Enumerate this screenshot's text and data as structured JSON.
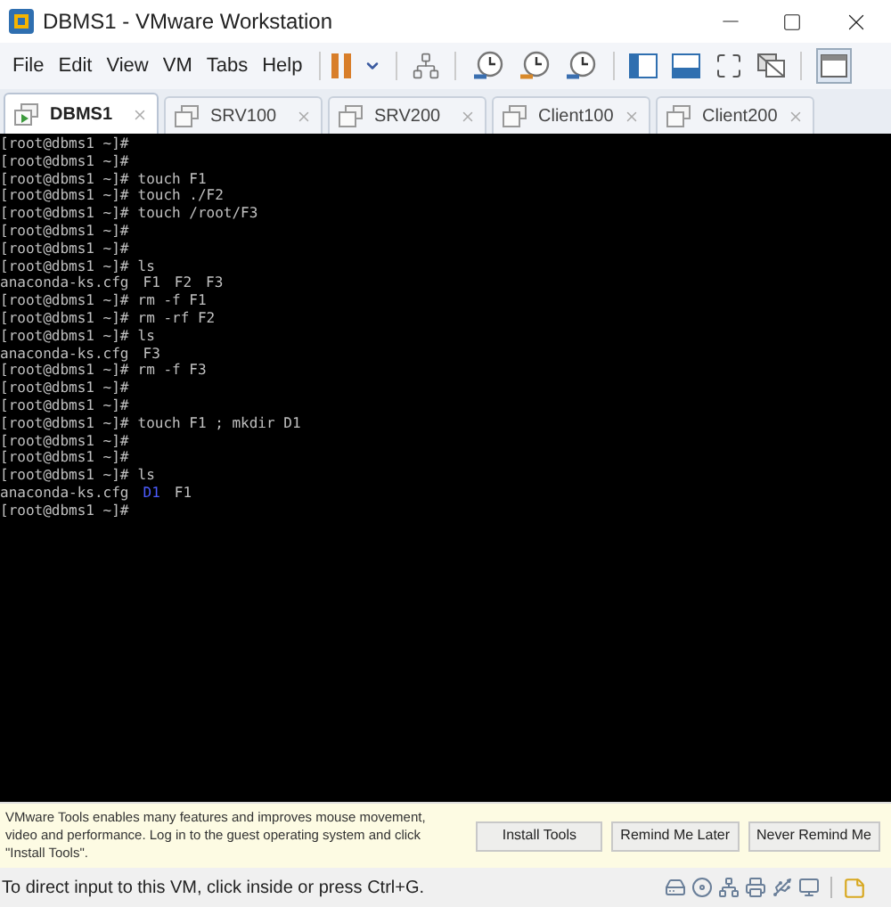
{
  "window": {
    "title": "DBMS1 - VMware Workstation"
  },
  "menu": [
    "File",
    "Edit",
    "View",
    "VM",
    "Tabs",
    "Help"
  ],
  "tabs": [
    {
      "label": "DBMS1",
      "selected": true
    },
    {
      "label": "SRV100",
      "selected": false
    },
    {
      "label": "SRV200",
      "selected": false
    },
    {
      "label": "Client100",
      "selected": false
    },
    {
      "label": "Client200",
      "selected": false
    }
  ],
  "terminal": {
    "lines": [
      {
        "kind": "prompt",
        "prompt": "[root@dbms1 ~]#"
      },
      {
        "kind": "prompt",
        "prompt": "[root@dbms1 ~]#"
      },
      {
        "kind": "prompt",
        "prompt": "[root@dbms1 ~]#",
        "command": "touch F1"
      },
      {
        "kind": "prompt",
        "prompt": "[root@dbms1 ~]#",
        "command": "touch ./F2"
      },
      {
        "kind": "prompt",
        "prompt": "[root@dbms1 ~]#",
        "command": "touch /root/F3"
      },
      {
        "kind": "prompt",
        "prompt": "[root@dbms1 ~]#"
      },
      {
        "kind": "prompt",
        "prompt": "[root@dbms1 ~]#"
      },
      {
        "kind": "prompt",
        "prompt": "[root@dbms1 ~]#",
        "command": "ls"
      },
      {
        "kind": "output",
        "items": [
          {
            "text": "anaconda-ks.cfg",
            "color": "#c0c0c0"
          },
          {
            "text": "F1",
            "color": "#c0c0c0"
          },
          {
            "text": "F2",
            "color": "#c0c0c0"
          },
          {
            "text": "F3",
            "color": "#c0c0c0"
          }
        ]
      },
      {
        "kind": "prompt",
        "prompt": "[root@dbms1 ~]#",
        "command": "rm -f F1"
      },
      {
        "kind": "prompt",
        "prompt": "[root@dbms1 ~]#",
        "command": "rm -rf F2"
      },
      {
        "kind": "prompt",
        "prompt": "[root@dbms1 ~]#",
        "command": "ls"
      },
      {
        "kind": "output",
        "items": [
          {
            "text": "anaconda-ks.cfg",
            "color": "#c0c0c0"
          },
          {
            "text": "F3",
            "color": "#c0c0c0"
          }
        ]
      },
      {
        "kind": "prompt",
        "prompt": "[root@dbms1 ~]#",
        "command": "rm -f F3"
      },
      {
        "kind": "prompt",
        "prompt": "[root@dbms1 ~]#"
      },
      {
        "kind": "prompt",
        "prompt": "[root@dbms1 ~]#"
      },
      {
        "kind": "prompt",
        "prompt": "[root@dbms1 ~]#",
        "command": "touch F1 ; mkdir D1"
      },
      {
        "kind": "prompt",
        "prompt": "[root@dbms1 ~]#"
      },
      {
        "kind": "prompt",
        "prompt": "[root@dbms1 ~]#"
      },
      {
        "kind": "prompt",
        "prompt": "[root@dbms1 ~]#",
        "command": "ls"
      },
      {
        "kind": "output",
        "items": [
          {
            "text": "anaconda-ks.cfg",
            "color": "#c0c0c0"
          },
          {
            "text": "D1",
            "color": "#4c5cff"
          },
          {
            "text": "F1",
            "color": "#c0c0c0"
          }
        ]
      },
      {
        "kind": "prompt",
        "prompt": "[root@dbms1 ~]#"
      }
    ]
  },
  "notification": {
    "message": "VMware Tools enables many features and improves mouse movement, video and performance. Log in to the guest operating system and click \"Install Tools\".",
    "buttons": [
      "Install Tools",
      "Remind Me Later",
      "Never Remind Me"
    ]
  },
  "status_bar": {
    "text": "To direct input to this VM, click inside or press Ctrl+G."
  }
}
